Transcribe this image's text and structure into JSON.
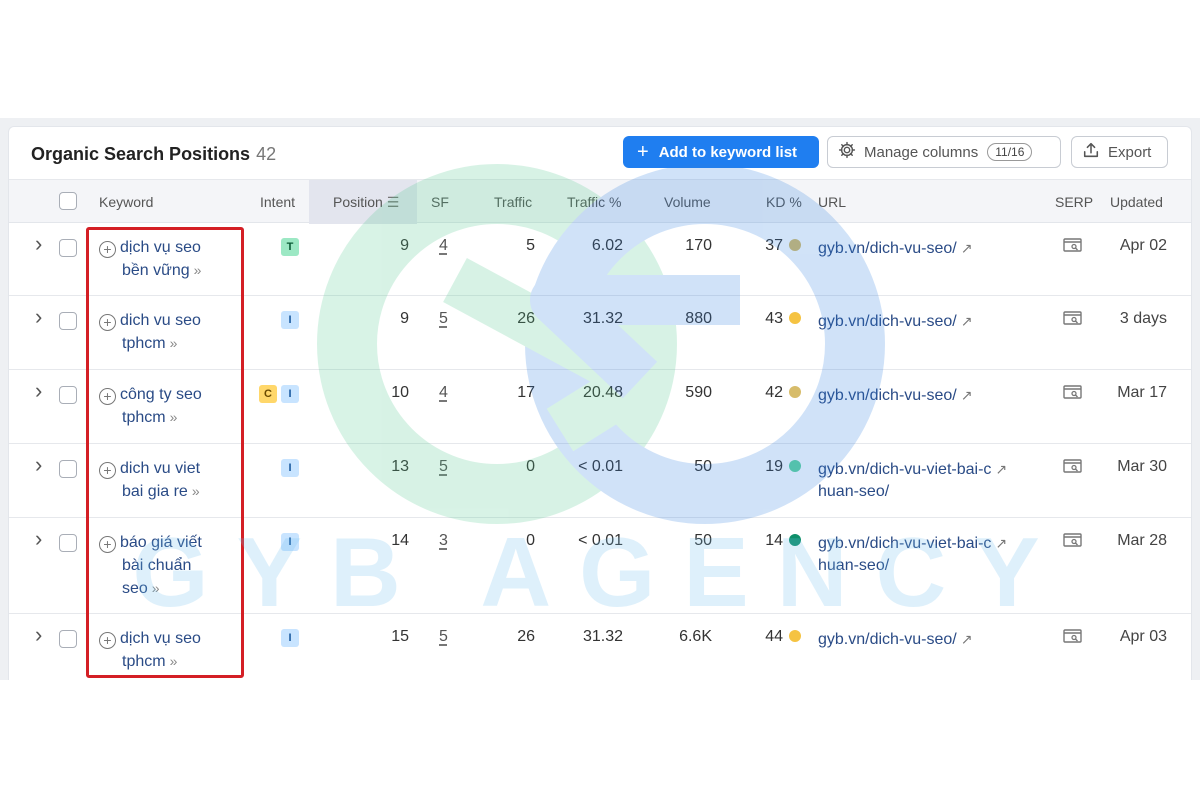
{
  "panel": {
    "title": "Organic Search Positions",
    "count": "42",
    "add_button": "Add to keyword list",
    "manage_button": "Manage columns",
    "manage_chip": "11/16",
    "export_button": "Export"
  },
  "columns": {
    "keyword": "Keyword",
    "intent": "Intent",
    "position": "Position",
    "sf": "SF",
    "traffic": "Traffic",
    "traffic_pct": "Traffic %",
    "volume": "Volume",
    "kd": "KD %",
    "url": "URL",
    "serp": "SERP",
    "updated": "Updated"
  },
  "rows": [
    {
      "kw1": "dịch vụ seo",
      "kw2": "bền vững",
      "kw3": "",
      "intents": [
        "T"
      ],
      "position": "9",
      "sf": "4",
      "traffic": "5",
      "traffic_pct": "6.02",
      "volume": "170",
      "kd": "37",
      "kd_color": "#d7bc6a",
      "url1": "gyb.vn/dich-vu-seo/",
      "url2": "",
      "updated": "Apr 02"
    },
    {
      "kw1": "dich vu seo",
      "kw2": "tphcm",
      "kw3": "",
      "intents": [
        "I"
      ],
      "position": "9",
      "sf": "5",
      "traffic": "26",
      "traffic_pct": "31.32",
      "volume": "880",
      "kd": "43",
      "kd_color": "#f5c342",
      "url1": "gyb.vn/dich-vu-seo/",
      "url2": "",
      "updated": "3 days"
    },
    {
      "kw1": "công ty seo",
      "kw2": "tphcm",
      "kw3": "",
      "intents": [
        "C",
        "I"
      ],
      "position": "10",
      "sf": "4",
      "traffic": "17",
      "traffic_pct": "20.48",
      "volume": "590",
      "kd": "42",
      "kd_color": "#d7bc6a",
      "url1": "gyb.vn/dich-vu-seo/",
      "url2": "",
      "updated": "Mar 17"
    },
    {
      "kw1": "dich vu viet",
      "kw2": "bai gia re",
      "kw3": "",
      "intents": [
        "I"
      ],
      "position": "13",
      "sf": "5",
      "traffic": "0",
      "traffic_pct": "< 0.01",
      "volume": "50",
      "kd": "19",
      "kd_color": "#5fd49f",
      "url1": "gyb.vn/dich-vu-viet-bai-c",
      "url2": "huan-seo/",
      "updated": "Mar 30"
    },
    {
      "kw1": "báo giá viết",
      "kw2": "bài chuẩn",
      "kw3": "seo",
      "intents": [
        "I"
      ],
      "position": "14",
      "sf": "3",
      "traffic": "0",
      "traffic_pct": "< 0.01",
      "volume": "50",
      "kd": "14",
      "kd_color": "#0e8f6a",
      "url1": "gyb.vn/dich-vu-viet-bai-c",
      "url2": "huan-seo/",
      "updated": "Mar 28"
    },
    {
      "kw1": "dịch vụ seo",
      "kw2": "tphcm",
      "kw3": "",
      "intents": [
        "I"
      ],
      "position": "15",
      "sf": "5",
      "traffic": "26",
      "traffic_pct": "31.32",
      "volume": "6.6K",
      "kd": "44",
      "kd_color": "#f5c342",
      "url1": "gyb.vn/dich-vu-seo/",
      "url2": "",
      "updated": "Apr 03"
    }
  ],
  "watermark": {
    "text": "GYB AGENCY"
  },
  "icons": {
    "expand": "chevron-right-icon",
    "add": "plus-circle-icon",
    "external": "external-link-icon",
    "serp": "serp-preview-icon",
    "manage": "gear-icon",
    "export": "upload-icon"
  },
  "colors": {
    "primary": "#1f7ef0",
    "highlight": "#d41f25",
    "link": "#2a4b86"
  }
}
